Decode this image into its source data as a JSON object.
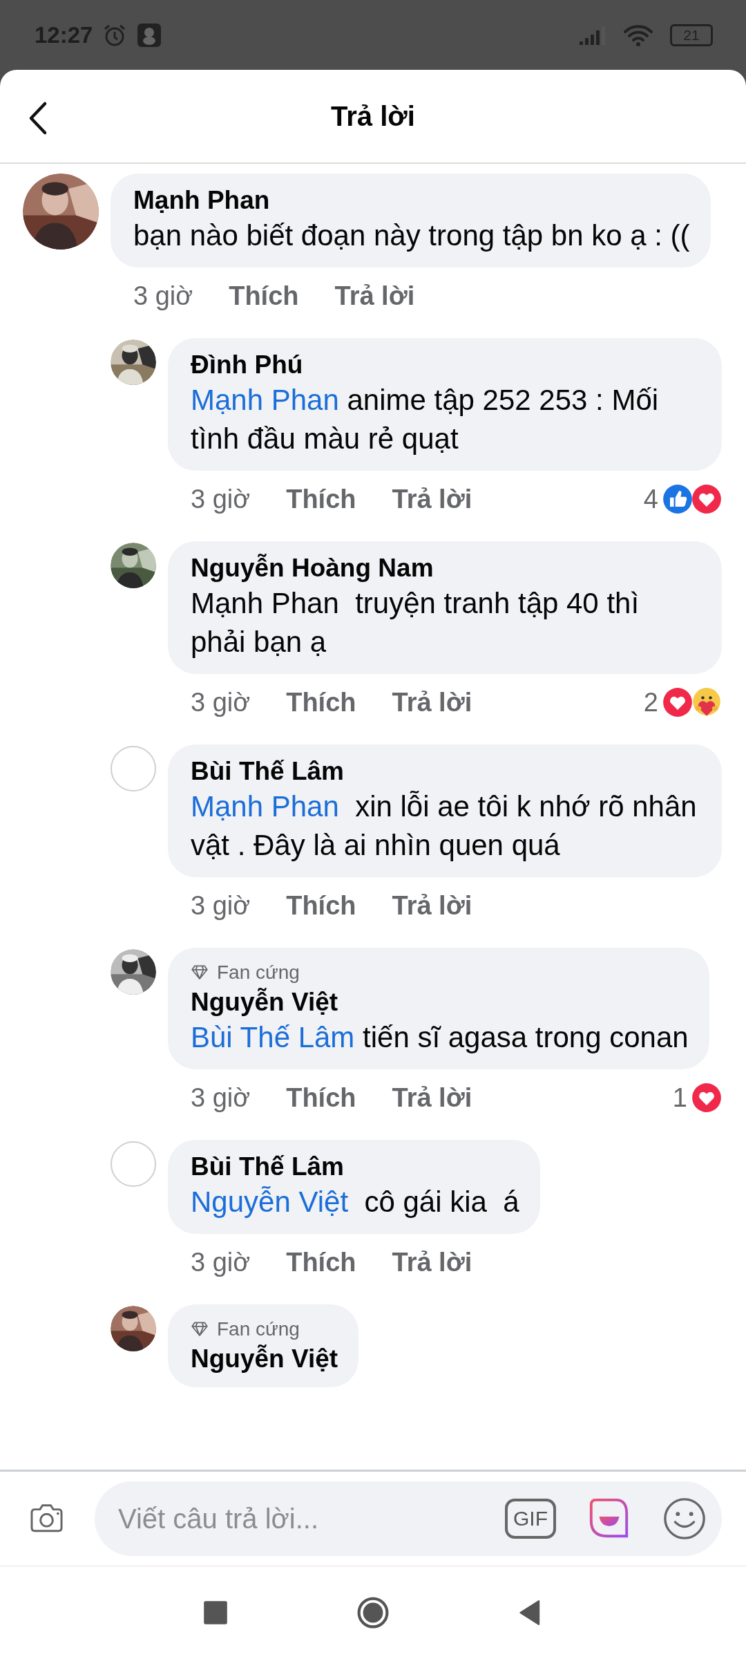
{
  "status_bar": {
    "time": "12:27",
    "battery": "21"
  },
  "header": {
    "title": "Trả lời"
  },
  "comments": [
    {
      "avatar": {
        "kind": "picture"
      },
      "name": "Mạnh Phan",
      "text": "bạn nào biết đoạn này trong tập bn ko ạ : ((",
      "time": "3 giờ",
      "like": "Thích",
      "reply": "Trả lời",
      "children": [
        {
          "avatar": {
            "kind": "picture"
          },
          "name": "Đình Phú",
          "mention": "Mạnh Phan",
          "text": " anime tập 252 253 : Mối tình đầu màu rẻ quạt",
          "time": "3 giờ",
          "like": "Thích",
          "reply": "Trả lời",
          "reaction_count": "4",
          "reactions": [
            {
              "kind": "like"
            },
            {
              "kind": "love"
            }
          ]
        },
        {
          "avatar": {
            "kind": "picture"
          },
          "name": "Nguyễn Hoàng Nam",
          "text": "Mạnh Phan  truyện tranh tập 40 thì phải bạn ạ",
          "time": "3 giờ",
          "like": "Thích",
          "reply": "Trả lời",
          "reaction_count": "2",
          "reactions": [
            {
              "kind": "love"
            },
            {
              "kind": "care"
            }
          ]
        },
        {
          "avatar": {
            "kind": "blank"
          },
          "name": "Bùi Thế Lâm",
          "mention": "Mạnh Phan",
          "text": "  xin lỗi ae tôi k nhớ rõ nhân vật . Đây là ai nhìn quen quá",
          "time": "3 giờ",
          "like": "Thích",
          "reply": "Trả lời"
        },
        {
          "avatar": {
            "kind": "picture"
          },
          "badge": "Fan cứng",
          "name": "Nguyễn Việt",
          "mention": "Bùi Thế Lâm",
          "text": " tiến sĩ agasa trong conan",
          "time": "3 giờ",
          "like": "Thích",
          "reply": "Trả lời",
          "reaction_count": "1",
          "reactions": [
            {
              "kind": "love"
            }
          ]
        },
        {
          "avatar": {
            "kind": "blank"
          },
          "name": "Bùi Thế Lâm",
          "mention": "Nguyễn Việt",
          "text": "  cô gái kia  á",
          "time": "3 giờ",
          "like": "Thích",
          "reply": "Trả lời"
        },
        {
          "avatar": {
            "kind": "picture"
          },
          "badge": "Fan cứng",
          "name": "Nguyễn Việt"
        }
      ]
    }
  ],
  "composer": {
    "placeholder": "Viết câu trả lời...",
    "gif_label": "GIF"
  }
}
